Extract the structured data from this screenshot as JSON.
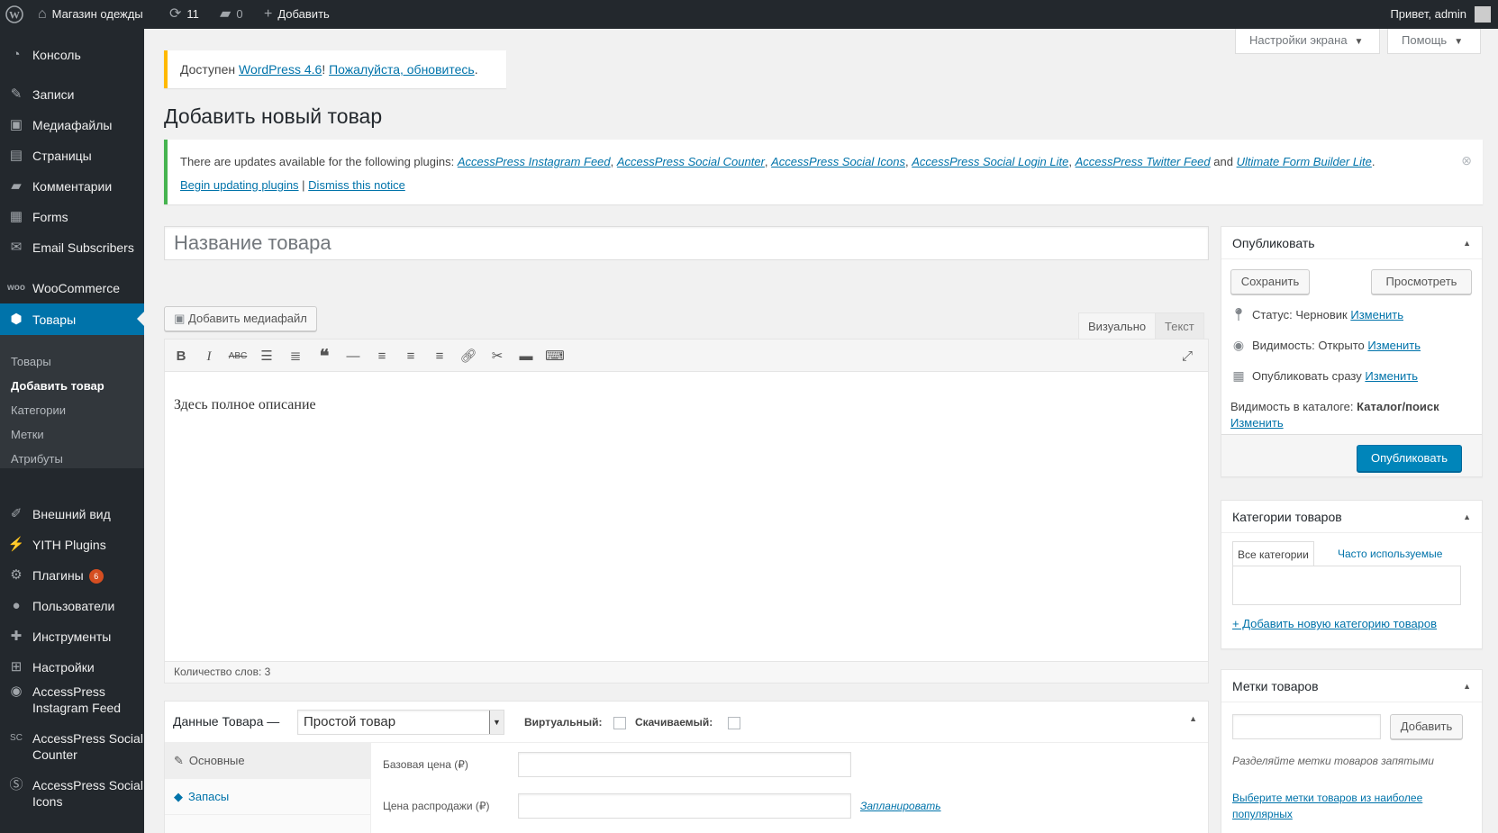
{
  "adminbar": {
    "site_name": "Магазин одежды",
    "updates_count": "11",
    "comments_count": "0",
    "add_new": "Добавить",
    "greeting": "Привет, admin"
  },
  "sidebar": {
    "items": [
      {
        "label": "Консоль",
        "icon": "dashboard-icon"
      },
      {
        "label": "Записи",
        "icon": "pin-icon"
      },
      {
        "label": "Медиафайлы",
        "icon": "media-icon"
      },
      {
        "label": "Страницы",
        "icon": "pages-icon"
      },
      {
        "label": "Комментарии",
        "icon": "comments-icon"
      },
      {
        "label": "Forms",
        "icon": "forms-icon"
      },
      {
        "label": "Email Subscribers",
        "icon": "email-icon"
      },
      {
        "label": "WooCommerce",
        "icon": "woo-icon"
      },
      {
        "label": "Товары",
        "icon": "products-icon"
      },
      {
        "label": "Внешний вид",
        "icon": "appearance-icon"
      },
      {
        "label": "YITH Plugins",
        "icon": "yith-icon"
      },
      {
        "label": "Плагины",
        "icon": "plugins-icon",
        "badge": "6"
      },
      {
        "label": "Пользователи",
        "icon": "users-icon"
      },
      {
        "label": "Инструменты",
        "icon": "tools-icon"
      },
      {
        "label": "Настройки",
        "icon": "settings-icon"
      },
      {
        "label": "AccessPress Instagram Feed",
        "icon": "instagram-icon"
      },
      {
        "label": "AccessPress Social Counter",
        "icon": "sc-icon"
      },
      {
        "label": "AccessPress Social Icons",
        "icon": "social-icon"
      }
    ],
    "submenu": [
      "Товары",
      "Добавить товар",
      "Категории",
      "Метки",
      "Атрибуты"
    ]
  },
  "screen_options": {
    "label": "Настройки экрана",
    "help": "Помощь"
  },
  "update_notice": {
    "prefix": "Доступен ",
    "link1": "WordPress 4.6",
    "sep": "! ",
    "link2": "Пожалуйста, обновитесь",
    "suffix": "."
  },
  "page_title": "Добавить новый товар",
  "plugins_notice": {
    "intro": "There are updates available for the following plugins: ",
    "plugins": [
      "AccessPress Instagram Feed",
      "AccessPress Social Counter",
      "AccessPress Social Icons",
      "AccessPress Social Login Lite",
      "AccessPress Twitter Feed"
    ],
    "and": " and ",
    "last_plugin": "Ultimate Form Builder Lite",
    "begin": "Begin updating plugins",
    "dismiss": "Dismiss this notice"
  },
  "title_placeholder": "Название товара",
  "editor": {
    "add_media": "Добавить медиафайл",
    "tab_visual": "Визуально",
    "tab_text": "Текст",
    "content": "Здесь полное описание",
    "word_count": "Количество слов: 3"
  },
  "product_data": {
    "title": "Данные Товара —",
    "type": "Простой товар",
    "virtual": "Виртуальный:",
    "downloadable": "Скачиваемый:",
    "tabs": [
      "Основные",
      "Запасы"
    ],
    "regular_price": "Базовая цена (₽)",
    "sale_price": "Цена распродажи (₽)",
    "schedule": "Запланировать"
  },
  "publish": {
    "title": "Опубликовать",
    "save": "Сохранить",
    "preview": "Просмотреть",
    "status_label": "Статус: Черновик",
    "visibility_label": "Видимость: Открыто",
    "schedule_label": "Опубликовать сразу",
    "edit": "Изменить",
    "catalog_label": "Видимость в каталоге: ",
    "catalog_value": "Каталог/поиск",
    "publish_btn": "Опубликовать"
  },
  "categories": {
    "title": "Категории товаров",
    "tab_all": "Все категории",
    "tab_popular": "Часто используемые",
    "add_new": "+ Добавить новую категорию товаров"
  },
  "tags": {
    "title": "Метки товаров",
    "add": "Добавить",
    "hint": "Разделяйте метки товаров запятыми",
    "choose": "Выберите метки товаров из наиболее популярных"
  }
}
